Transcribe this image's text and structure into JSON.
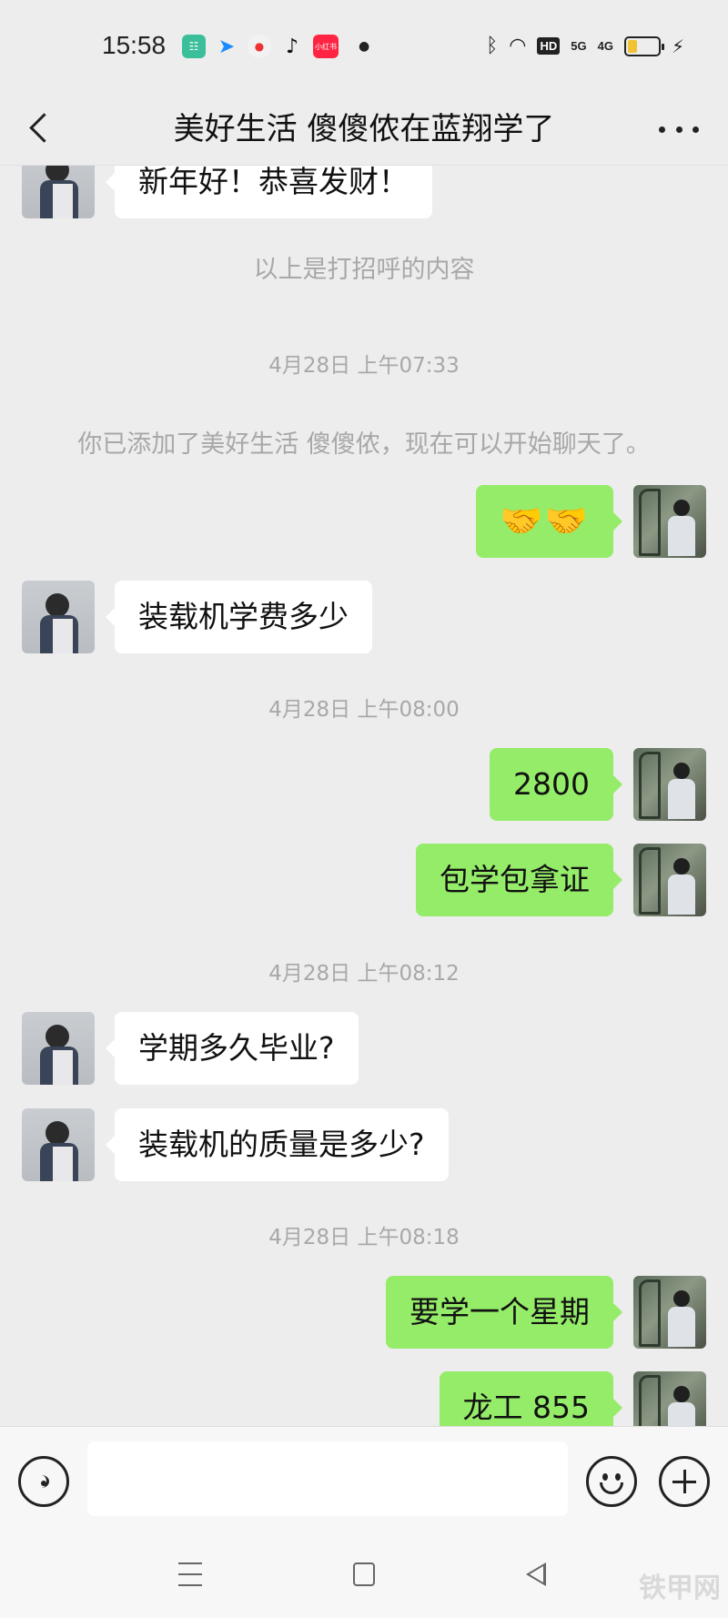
{
  "status_bar": {
    "time": "15:58",
    "sig_5g": "5G",
    "sig_4g": "4G",
    "hd": "HD",
    "notification_app_label": "小红书"
  },
  "header": {
    "title": "美好生活  傻傻侬在蓝翔学了"
  },
  "messages": {
    "m1_text": "新年好！恭喜发财！",
    "sys_greeting": "以上是打招呼的内容",
    "ts1": "4月28日 上午07:33",
    "sys_added": "你已添加了美好生活  傻傻侬，现在可以开始聊天了。",
    "m2_text": "🤝🤝",
    "m3_text": "装载机学费多少",
    "ts2": "4月28日 上午08:00",
    "m4_text": "2800",
    "m5_text": "包学包拿证",
    "ts3": "4月28日 上午08:12",
    "m6_text": "学期多久毕业?",
    "m7_text": "装载机的质量是多少?",
    "ts4": "4月28日 上午08:18",
    "m8_text": "要学一个星期",
    "m9_text": "龙工 855"
  },
  "input_bar": {
    "placeholder": ""
  },
  "watermark": "铁甲网",
  "colors": {
    "background": "#ededed",
    "self_bubble": "#95ec69",
    "other_bubble": "#ffffff",
    "system_text": "#a8a8a8"
  },
  "icons": {
    "back": "chevron-left-icon",
    "more": "more-dots-icon",
    "voice": "voice-icon",
    "emoji": "emoji-icon",
    "plus": "plus-icon"
  }
}
